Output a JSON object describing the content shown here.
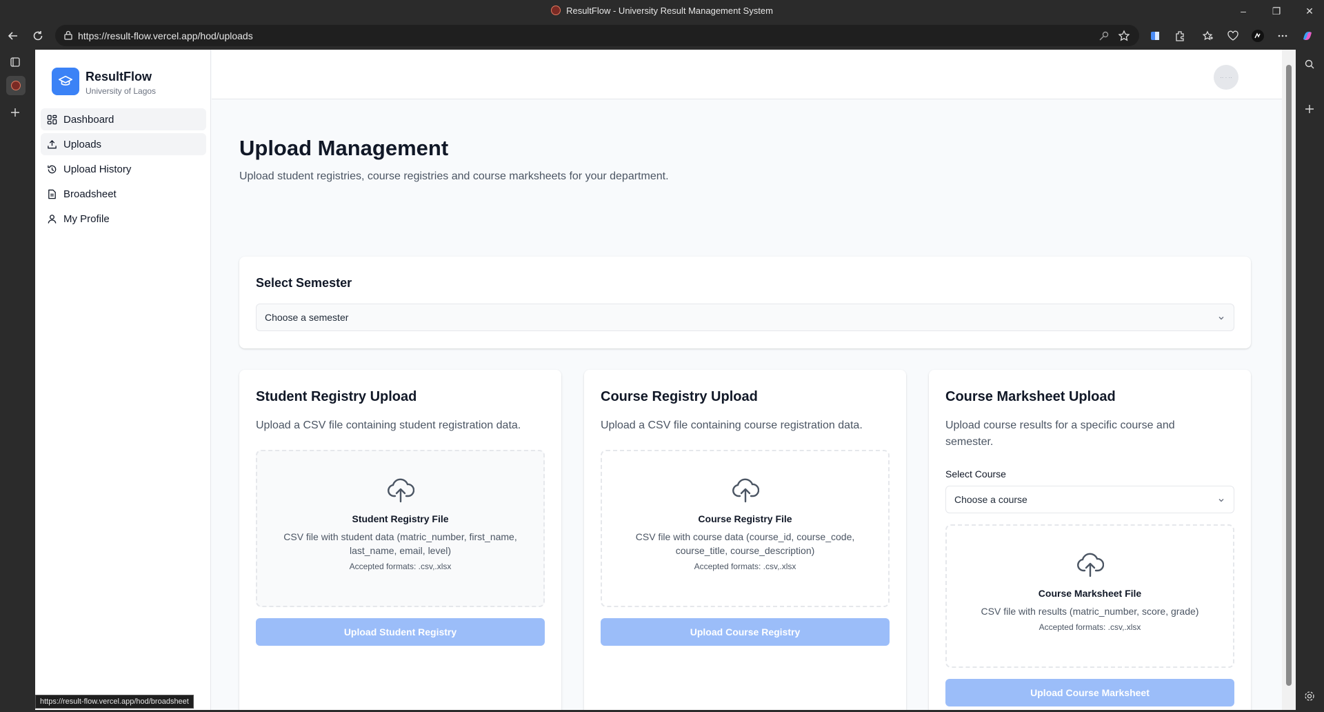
{
  "browser": {
    "window_title": "ResultFlow - University Result Management System",
    "url": "https://result-flow.vercel.app/hod/uploads",
    "status_url": "https://result-flow.vercel.app/hod/broadsheet"
  },
  "sidebar": {
    "brand_name": "ResultFlow",
    "brand_sub": "University of Lagos",
    "items": [
      {
        "label": "Dashboard",
        "icon": "dashboard-icon"
      },
      {
        "label": "Uploads",
        "icon": "upload-icon"
      },
      {
        "label": "Upload History",
        "icon": "history-icon"
      },
      {
        "label": "Broadsheet",
        "icon": "document-icon"
      },
      {
        "label": "My Profile",
        "icon": "user-icon"
      }
    ]
  },
  "header": {
    "avatar_text": "·· · ··"
  },
  "main": {
    "title": "Upload Management",
    "subtitle": "Upload student registries, course registries and course marksheets for your department."
  },
  "semester": {
    "title": "Select Semester",
    "placeholder": "Choose a semester"
  },
  "cards": [
    {
      "title": "Student Registry Upload",
      "desc": "Upload a CSV file containing student registration data.",
      "file_title": "Student Registry File",
      "file_desc": "CSV file with student data (matric_number, first_name, last_name, email, level)",
      "formats": "Accepted formats: .csv,.xlsx",
      "button": "Upload Student Registry"
    },
    {
      "title": "Course Registry Upload",
      "desc": "Upload a CSV file containing course registration data.",
      "file_title": "Course Registry File",
      "file_desc": "CSV file with course data (course_id, course_code, course_title, course_description)",
      "formats": "Accepted formats: .csv,.xlsx",
      "button": "Upload Course Registry"
    },
    {
      "title": "Course Marksheet Upload",
      "desc": "Upload course results for a specific course and semester.",
      "course_label": "Select Course",
      "course_placeholder": "Choose a course",
      "file_title": "Course Marksheet File",
      "file_desc": "CSV file with results (matric_number, score, grade)",
      "formats": "Accepted formats: .csv,.xlsx",
      "button": "Upload Course Marksheet"
    }
  ],
  "colors": {
    "brand": "#3b82f6",
    "button_disabled": "#9bbdf9"
  }
}
